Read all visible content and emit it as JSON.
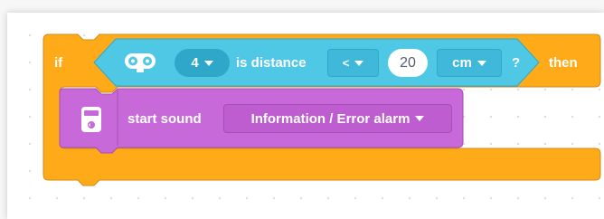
{
  "if_block": {
    "if_label": "if",
    "then_label": "then"
  },
  "condition": {
    "port_value": "4",
    "is_distance_label": "is distance",
    "operator_value": "<",
    "threshold_value": "20",
    "unit_value": "cm",
    "help_label": "?"
  },
  "sound_block": {
    "label": "start sound",
    "sound_value": "Information / Error alarm"
  },
  "icons": {
    "sensor": "ultrasonic-sensor-icon",
    "speaker": "hub-speaker-icon",
    "dropdown": "chevron-down-icon"
  },
  "colors": {
    "control": "#FFAB19",
    "control_dark": "#CF8B17",
    "sensor": "#4FC8E6",
    "sensor_dark": "#2EA7C9",
    "field_bg": "#3FB8DA",
    "sound": "#C769D9",
    "sound_dark": "#A54EB5",
    "field_sound": "#BD5DCF"
  }
}
